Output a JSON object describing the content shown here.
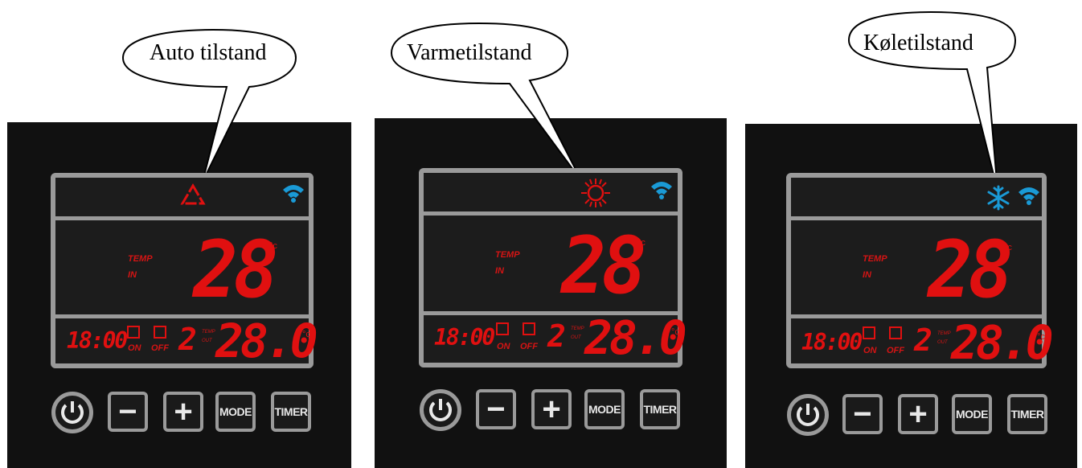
{
  "colors": {
    "panel": "#111111",
    "lcd_border": "#9a9a9a",
    "digit_red": "#e01010",
    "wifi_blue": "#1a9ad6",
    "snow_blue": "#1a9ad6"
  },
  "panels": [
    {
      "callout": "Auto tilstand",
      "mode_icon": "recycle-triangle-icon",
      "temp_label_1": "TEMP",
      "temp_label_2": "IN",
      "temp": "28",
      "temp_unit": "°c",
      "clock": "18:00",
      "on_label": "ON",
      "off_label": "OFF",
      "timer_num": "2",
      "out_label_1": "TEMP",
      "out_label_2": "OUT",
      "out_temp": "28.0",
      "out_unit": "°c",
      "buttons": {
        "minus": "−",
        "plus": "+",
        "mode": "MODE",
        "timer": "TIMER"
      }
    },
    {
      "callout": "Varmetilstand",
      "mode_icon": "sun-icon",
      "temp_label_1": "TEMP",
      "temp_label_2": "IN",
      "temp": "28",
      "temp_unit": "°c",
      "clock": "18:00",
      "on_label": "ON",
      "off_label": "OFF",
      "timer_num": "2",
      "out_label_1": "TEMP",
      "out_label_2": "OUT",
      "out_temp": "28.0",
      "out_unit": "°c",
      "buttons": {
        "minus": "−",
        "plus": "+",
        "mode": "MODE",
        "timer": "TIMER"
      }
    },
    {
      "callout": "Køletilstand",
      "mode_icon": "snowflake-icon",
      "temp_label_1": "TEMP",
      "temp_label_2": "IN",
      "temp": "28",
      "temp_unit": "°c",
      "clock": "18:00",
      "on_label": "ON",
      "off_label": "OFF",
      "timer_num": "2",
      "out_label_1": "TEMP",
      "out_label_2": "OUT",
      "out_temp": "28.0",
      "out_unit": "°c",
      "buttons": {
        "minus": "−",
        "plus": "+",
        "mode": "MODE",
        "timer": "TIMER"
      }
    }
  ]
}
